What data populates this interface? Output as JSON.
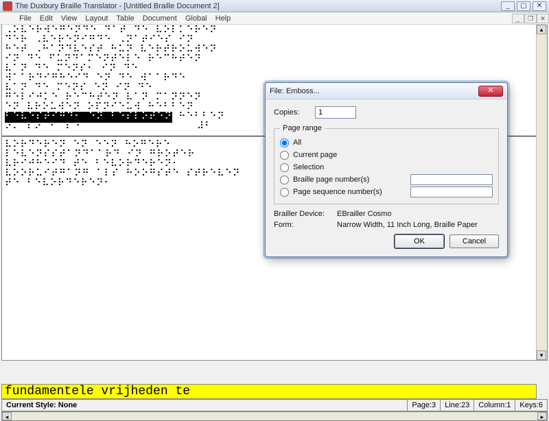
{
  "window": {
    "title": "The Duxbury Braille Translator - [Untitled Braille Document 2]",
    "controls": {
      "min": "_",
      "max": "▢",
      "close": "✕"
    }
  },
  "mdi": {
    "min": "_",
    "restore": "❐",
    "close": "✕"
  },
  "menu": [
    "File",
    "Edit",
    "View",
    "Layout",
    "Table",
    "Document",
    "Global",
    "Help"
  ],
  "braille_block1": "⠠⠕⠧⠑⠗⠺⠑⠛⠑⠝⠙⠑ ⠙⠁⠞ ⠙⠑ ⠧⠕⠇⠅⠑⠗⠑⠝\n⠙⠑⠗ ⠠⠧⠑⠗⠑⠝⠊⠛⠙⠑ ⠠⠝⠁⠞⠊⠑⠎ ⠊⠝\n⠓⠑⠞ ⠠⠓⠁⠝⠙⠧⠑⠎⠞ ⠓⠥⠝ ⠧⠑⠗⠞⠗⠕⠥⠺⠑⠝\n⠊⠝ ⠙⠑ ⠋⠥⠝⠙⠁⠍⠑⠝⠞⠑⠇⠑ ⠗⠑⠉⠓⠞⠑⠝\n⠧⠁⠝ ⠙⠑ ⠍⠑⠝⠎⠂ ⠊⠝ ⠙⠑\n⠺⠁⠁⠗⠙⠊⠛⠓⠑⠊⠙ ⠑⠝ ⠙⠑ ⠺⠁⠁⠗⠙⠑\n⠧⠁⠝ ⠙⠑ ⠍⠑⠝⠎ ⠑⠝ ⠊⠝ ⠙⠑\n⠛⠑⠇⠊⠚⠅⠑ ⠗⠑⠉⠓⠞⠑⠝ ⠧⠁⠝ ⠍⠁⠝⠝⠑⠝\n⠑⠝ ⠧⠗⠕⠥⠺⠑⠝ ⠕⠏⠝⠊⠑⠥⠺ ⠓⠑⠃⠃⠑⠝\n",
  "braille_sel": "⠃⠑⠧⠑⠎⠞⠊⠛⠙⠂ ⠑⠝ ⠃⠑⠎⠇⠕⠞⠑⠝",
  "braille_after_sel": " ⠓⠑⠃⠃⠑⠝",
  "braille_line_end": "⠕⠍ ⠎⠕⠉⠊⠁⠇⠑                  ⠼⠃",
  "braille_block2": "⠧⠕⠗⠙⠑⠗⠑⠝ ⠑⠝ ⠑⠑⠝ ⠓⠕⠛⠑⠗⠑\n⠇⠑⠧⠑⠝⠎⠎⠞⠁⠝⠙⠁⠁⠗⠙ ⠊⠝ ⠛⠗⠕⠞⠑⠗\n⠧⠗⠊⠚⠓⠑⠊⠙ ⠞⠑ ⠃⠑⠧⠕⠗⠙⠑⠗⠑⠝⠂\n⠧⠕⠕⠗⠥⠊⠞⠛⠁⠝⠛ ⠁⠇⠎ ⠓⠕⠕⠛⠎⠞⠑ ⠎⠞⠗⠑⠧⠑⠝\n⠞⠑ ⠃⠑⠧⠕⠗⠙⠑⠗⠑⠝⠂",
  "dialog": {
    "title": "File: Emboss...",
    "close": "✕",
    "copies_label": "Copies:",
    "copies_value": "1",
    "page_range_legend": "Page range",
    "opts": {
      "all": "All",
      "current": "Current page",
      "selection": "Selection",
      "braille_nums": "Braille page number(s)",
      "seq_nums": "Page sequence number(s)"
    },
    "device_label": "Brailler Device:",
    "device_value": "EBrailler Cosmo",
    "form_label": "Form:",
    "form_value": "Narrow Width, 11 Inch Long, Braille Paper",
    "ok": "OK",
    "cancel": "Cancel"
  },
  "translated": "fundamentele vrijheden te",
  "status": {
    "style": "Current Style: None",
    "page": "Page:3",
    "line": "Line:23",
    "col": "Column:1",
    "keys": "Keys:6"
  }
}
